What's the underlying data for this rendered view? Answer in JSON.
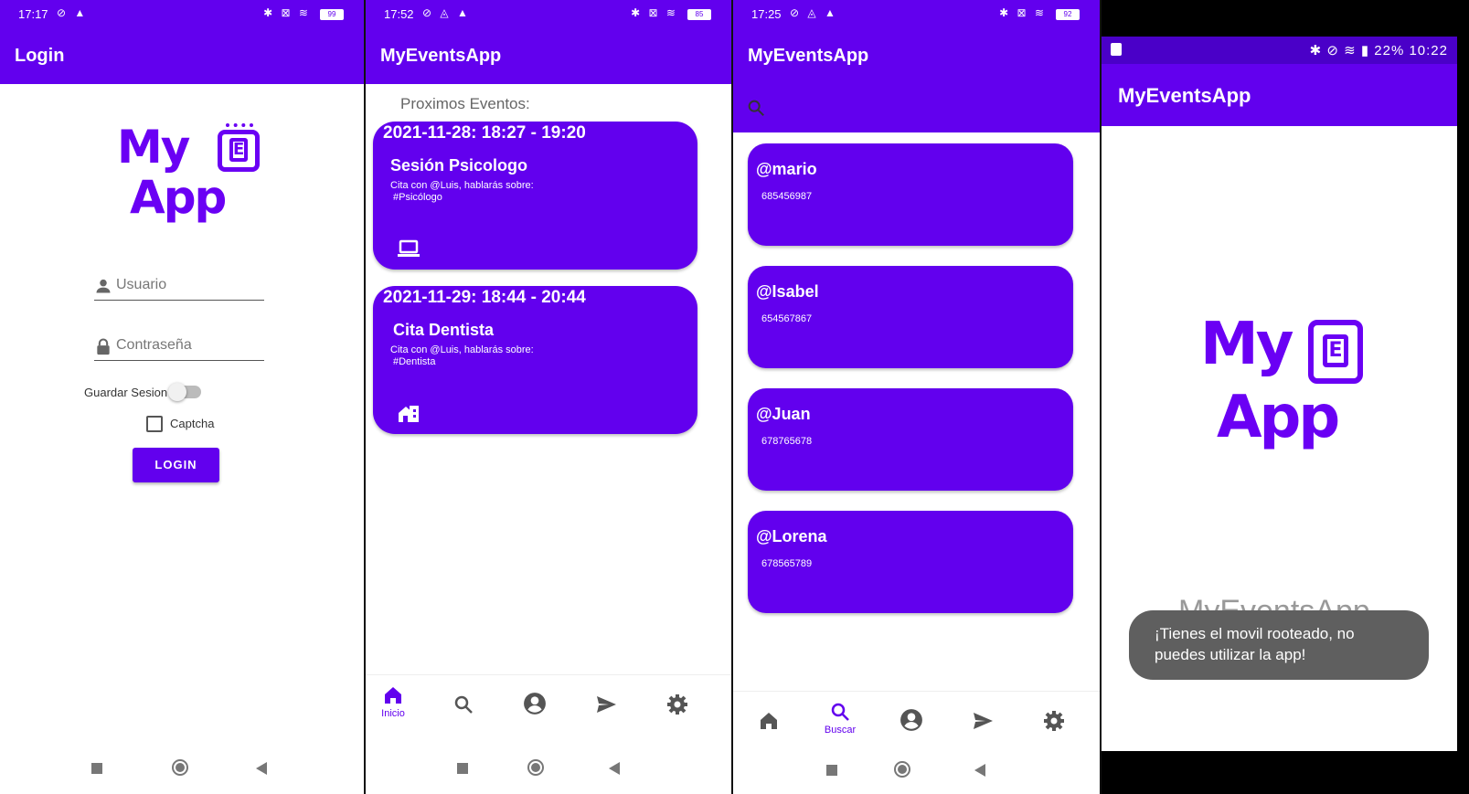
{
  "colors": {
    "primary": "#6200ee",
    "primary_dark": "#4a00c8",
    "toast_bg": "#5f5f5f"
  },
  "login_screen": {
    "status_time": "17:17",
    "battery": "99",
    "title": "Login",
    "logo_line1": "My",
    "logo_letter": "E",
    "logo_line2": "App",
    "username_placeholder": "Usuario",
    "password_placeholder": "Contraseña",
    "save_session_label": "Guardar Sesion",
    "captcha_label": "Captcha",
    "login_button": "LOGIN"
  },
  "events_screen": {
    "status_time": "17:52",
    "battery": "85",
    "title": "MyEventsApp",
    "section_title": "Proximos Eventos:",
    "events": [
      {
        "date": "2021-11-28: 18:27 - 19:20",
        "title": "Sesión Psicologo",
        "description": "Cita con @Luis, hablarás sobre:",
        "tag": "#Psicólogo",
        "icon": "laptop-icon"
      },
      {
        "date": "2021-11-29: 18:44 - 20:44",
        "title": "Cita Dentista",
        "description": "Cita con @Luis, hablarás sobre:",
        "tag": "#Dentista",
        "icon": "building-icon"
      }
    ],
    "nav_active_label": "Inicio"
  },
  "search_screen": {
    "status_time": "17:25",
    "battery": "92",
    "title": "MyEventsApp",
    "users": [
      {
        "name": "@mario",
        "phone": "685456987"
      },
      {
        "name": "@Isabel",
        "phone": "654567867"
      },
      {
        "name": "@Juan",
        "phone": "678765678"
      },
      {
        "name": "@Lorena",
        "phone": "678565789"
      }
    ],
    "nav_active_label": "Buscar"
  },
  "rooted_screen": {
    "status_right": "22% 10:22",
    "title": "MyEventsApp",
    "logo_line1": "My",
    "logo_letter": "E",
    "logo_line2": "App",
    "faded_app_name": "MyEventsApp",
    "toast_message": "¡Tienes el movil rooteado, no puedes utilizar la app!"
  }
}
